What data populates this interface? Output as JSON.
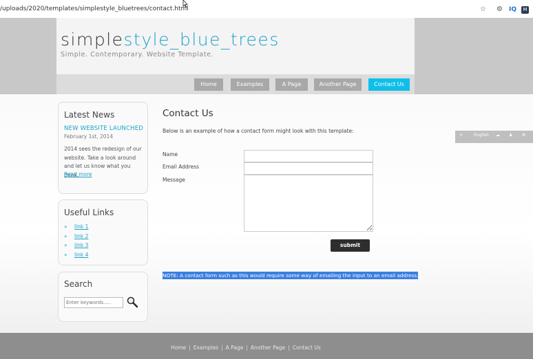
{
  "browser": {
    "url": "/uploads/2020/templates/simplestyle_bluetrees/contact.html",
    "icons": [
      "star-icon",
      "settings-icon",
      "iq-icon",
      "m-extension-icon"
    ],
    "iq_label": "IQ",
    "m_label": "M"
  },
  "site": {
    "logo_part1": "simple",
    "logo_part2": "style_blue_trees",
    "slogan": "Simple. Contemporary. Website Template.",
    "colors": {
      "accent": "#1aa3c7",
      "menu_selected": "#10bfe9",
      "menu": "#a8a8a8"
    }
  },
  "menu": {
    "items": [
      "Home",
      "Examples",
      "A Page",
      "Another Page",
      "Contact Us"
    ],
    "selected": "Contact Us"
  },
  "sidebar": {
    "news": {
      "title": "Latest News",
      "headline": "NEW WEBSITE LAUNCHED",
      "date": "February 1st, 2014",
      "body": "2014 sees the redesign of our website. Take a look around and let us know what you think.",
      "read_more": "Read more"
    },
    "links": {
      "title": "Useful Links",
      "items": [
        "link 1",
        "link 2",
        "link 3",
        "link 4"
      ]
    },
    "search": {
      "title": "Search",
      "placeholder": "Enter keywords....."
    }
  },
  "main": {
    "title": "Contact Us",
    "intro": "Below is an example of how a contact form might look with this template:",
    "fields": {
      "name": "Name",
      "email": "Email Address",
      "message": "Message"
    },
    "submit": "submit",
    "note": "NOTE: A contact form such as this would require some way of emailing the input to an email address."
  },
  "translate_widget": {
    "language": "English"
  },
  "footer": {
    "links": [
      "Home",
      "Examples",
      "A Page",
      "Another Page",
      "Contact Us"
    ]
  }
}
